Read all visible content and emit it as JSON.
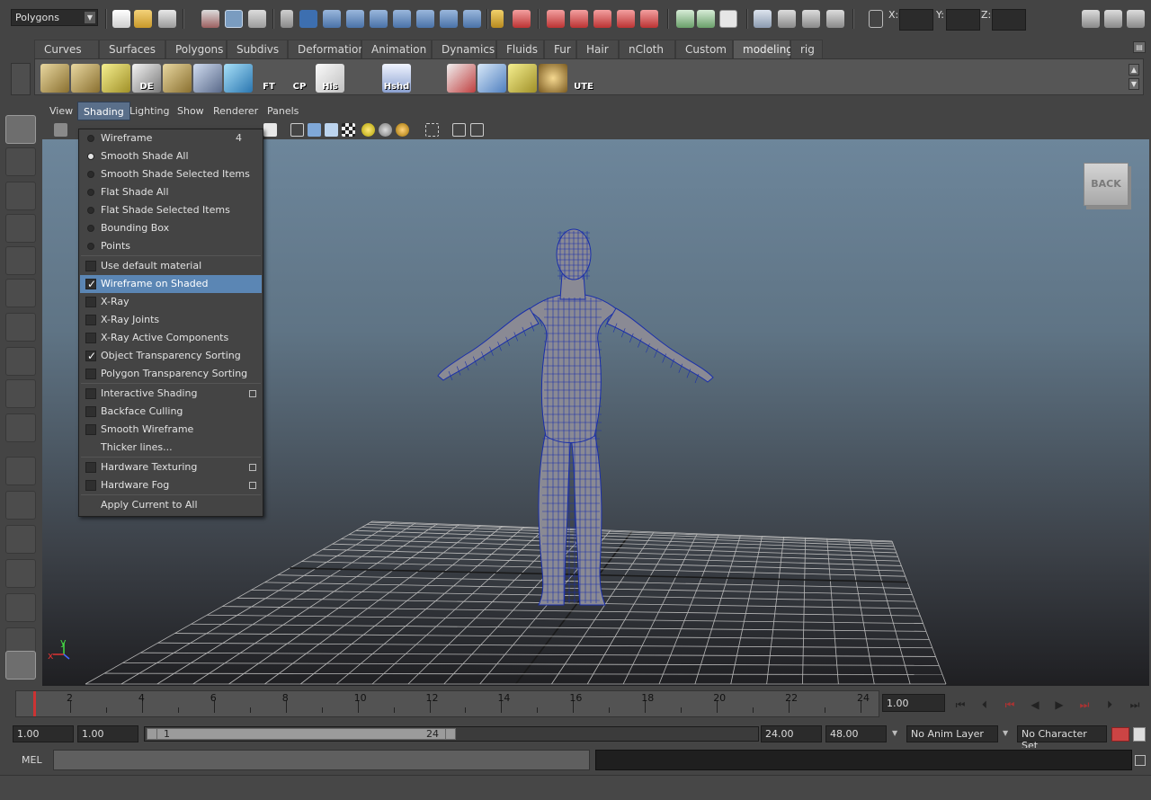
{
  "statusline": {
    "mode": "Polygons",
    "x_label": "X:",
    "y_label": "Y:",
    "z_label": "Z:"
  },
  "shelf": {
    "tabs": [
      "Curves",
      "Surfaces",
      "Polygons",
      "Subdivs",
      "Deformation",
      "Animation",
      "Dynamics",
      "Fluids",
      "Fur",
      "Hair",
      "nCloth",
      "Custom",
      "modeling",
      "rig"
    ],
    "active_tab": "modeling",
    "icon_labels": {
      "de": "DE",
      "ft": "FT",
      "cp": "CP",
      "his": "His",
      "hshd": "Hshd",
      "ute": "UTE"
    }
  },
  "panel_menu": [
    "View",
    "Shading",
    "Lighting",
    "Show",
    "Renderer",
    "Panels"
  ],
  "shading_menu": {
    "items": [
      {
        "label": "Wireframe",
        "type": "radio",
        "on": false,
        "hotkey": "4"
      },
      {
        "label": "Smooth Shade All",
        "type": "radio",
        "on": true
      },
      {
        "label": "Smooth Shade Selected Items",
        "type": "radio",
        "on": false
      },
      {
        "label": "Flat Shade All",
        "type": "radio",
        "on": false
      },
      {
        "label": "Flat Shade Selected Items",
        "type": "radio",
        "on": false
      },
      {
        "label": "Bounding Box",
        "type": "radio",
        "on": false
      },
      {
        "label": "Points",
        "type": "radio",
        "on": false
      },
      {
        "label": "Use default material",
        "type": "check",
        "on": false
      },
      {
        "label": "Wireframe on Shaded",
        "type": "check",
        "on": true,
        "highlight": true
      },
      {
        "label": "X-Ray",
        "type": "check",
        "on": false
      },
      {
        "label": "X-Ray Joints",
        "type": "check",
        "on": false
      },
      {
        "label": "X-Ray Active Components",
        "type": "check",
        "on": false
      },
      {
        "label": "Object Transparency Sorting",
        "type": "check",
        "on": true
      },
      {
        "label": "Polygon Transparency Sorting",
        "type": "check",
        "on": false
      },
      {
        "label": "Interactive Shading",
        "type": "check",
        "on": false,
        "option": true
      },
      {
        "label": "Backface Culling",
        "type": "check",
        "on": false
      },
      {
        "label": "Smooth Wireframe",
        "type": "check",
        "on": false
      },
      {
        "label": "Thicker lines...",
        "type": "plain"
      },
      {
        "label": "Hardware Texturing",
        "type": "check",
        "on": false,
        "option": true
      },
      {
        "label": "Hardware Fog",
        "type": "check",
        "on": false,
        "option": true
      },
      {
        "label": "Apply Current to All",
        "type": "plain"
      }
    ]
  },
  "viewport": {
    "view_cube_label": "BACK",
    "axis_x": "x",
    "axis_y": "y"
  },
  "timeslider": {
    "tick_labels": [
      "2",
      "4",
      "6",
      "8",
      "10",
      "12",
      "14",
      "16",
      "18",
      "20",
      "22",
      "24"
    ],
    "current_time": "1.00"
  },
  "rangeslider": {
    "start_time": "1.00",
    "playback_start": "1.00",
    "range_start": "1",
    "range_end": "24",
    "playback_end": "24.00",
    "end_time": "48.00",
    "anim_layer": "No Anim Layer",
    "character_set": "No Character Set"
  },
  "cmdline": {
    "label": "MEL"
  },
  "colors": {
    "menu_highlight": "#5b86b4",
    "wireframe": "#1a2faa",
    "mesh": "#8a8a94"
  }
}
